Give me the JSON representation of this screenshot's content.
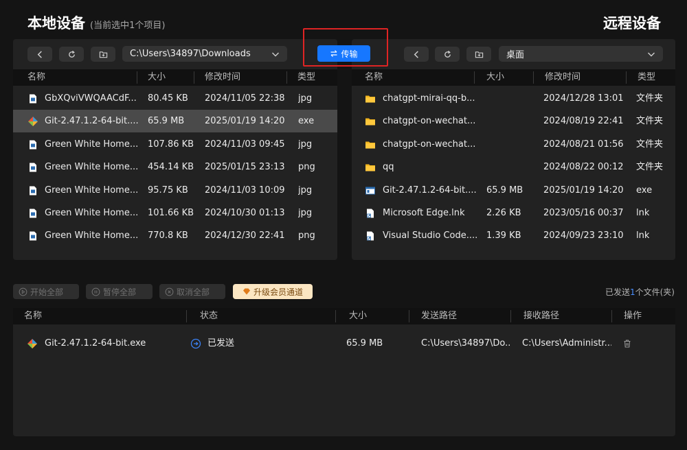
{
  "header": {
    "local_title": "本地设备",
    "local_subtitle": "(当前选中1个项目)",
    "remote_title": "远程设备"
  },
  "local": {
    "path": "C:\\Users\\34897\\Downloads",
    "columns": [
      "名称",
      "大小",
      "修改时间",
      "类型"
    ],
    "files": [
      {
        "name": "GbXQviVWQAACdF...",
        "size": "80.45 KB",
        "modified": "2024/11/05 22:38",
        "type": "jpg",
        "icon": "image-file-icon",
        "selected": false
      },
      {
        "name": "Git-2.47.1.2-64-bit....",
        "size": "65.9 MB",
        "modified": "2025/01/19 14:20",
        "type": "exe",
        "icon": "git-icon",
        "selected": true
      },
      {
        "name": "Green White Home...",
        "size": "107.86 KB",
        "modified": "2024/11/03 09:45",
        "type": "jpg",
        "icon": "image-file-icon",
        "selected": false
      },
      {
        "name": "Green White Home...",
        "size": "454.14 KB",
        "modified": "2025/01/15 23:13",
        "type": "png",
        "icon": "image-file-icon",
        "selected": false
      },
      {
        "name": "Green White Home...",
        "size": "95.75 KB",
        "modified": "2024/11/03 10:09",
        "type": "jpg",
        "icon": "image-file-icon",
        "selected": false
      },
      {
        "name": "Green White Home...",
        "size": "101.66 KB",
        "modified": "2024/10/30 01:13",
        "type": "jpg",
        "icon": "image-file-icon",
        "selected": false
      },
      {
        "name": "Green White Home...",
        "size": "770.8 KB",
        "modified": "2024/12/30 22:41",
        "type": "png",
        "icon": "image-file-icon",
        "selected": false
      }
    ]
  },
  "transfer_button": "传输",
  "remote": {
    "path": "桌面",
    "columns": [
      "名称",
      "大小",
      "修改时间",
      "类型"
    ],
    "files": [
      {
        "name": "chatgpt-mirai-qq-b...",
        "size": "",
        "modified": "2024/12/28 13:01",
        "type": "文件夹",
        "icon": "folder-icon"
      },
      {
        "name": "chatgpt-on-wechat...",
        "size": "",
        "modified": "2024/08/19 22:41",
        "type": "文件夹",
        "icon": "folder-icon"
      },
      {
        "name": "chatgpt-on-wechat...",
        "size": "",
        "modified": "2024/08/21 01:56",
        "type": "文件夹",
        "icon": "folder-icon"
      },
      {
        "name": "qq",
        "size": "",
        "modified": "2024/08/22 00:12",
        "type": "文件夹",
        "icon": "folder-icon"
      },
      {
        "name": "Git-2.47.1.2-64-bit....",
        "size": "65.9 MB",
        "modified": "2025/01/19 14:20",
        "type": "exe",
        "icon": "exe-file-icon"
      },
      {
        "name": "Microsoft Edge.lnk",
        "size": "2.26 KB",
        "modified": "2023/05/16 00:37",
        "type": "lnk",
        "icon": "shortcut-icon"
      },
      {
        "name": "Visual Studio Code....",
        "size": "1.39 KB",
        "modified": "2024/09/23 23:10",
        "type": "lnk",
        "icon": "shortcut-icon"
      }
    ]
  },
  "actions": {
    "start_all": "开始全部",
    "pause_all": "暂停全部",
    "cancel_all": "取消全部",
    "upgrade": "升级会员通道",
    "summary_prefix": "已发送",
    "summary_count": "1",
    "summary_suffix": "个文件(夹)"
  },
  "transfers": {
    "columns": [
      "名称",
      "状态",
      "大小",
      "发送路径",
      "接收路径",
      "操作"
    ],
    "rows": [
      {
        "name": "Git-2.47.1.2-64-bit.exe",
        "status": "已发送",
        "size": "65.9 MB",
        "send_path": "C:\\Users\\34897\\Do...",
        "recv_path": "C:\\Users\\Administr..."
      }
    ]
  },
  "colors": {
    "accent": "#1677ff",
    "highlight": "#e02424",
    "vip": "#fbe6c2"
  }
}
